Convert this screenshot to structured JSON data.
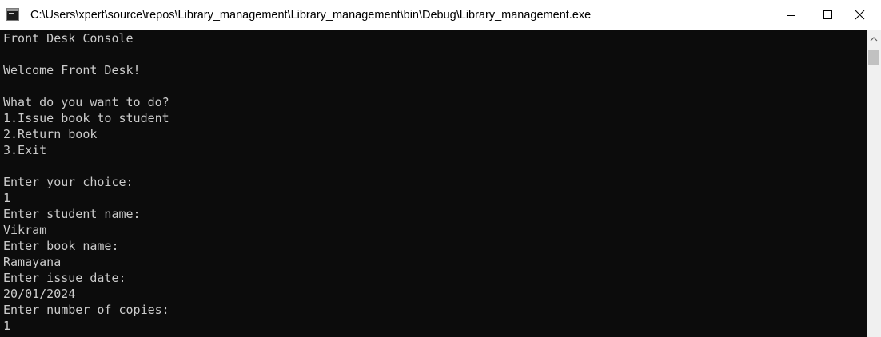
{
  "window": {
    "title": "C:\\Users\\xpert\\source\\repos\\Library_management\\Library_management\\bin\\Debug\\Library_management.exe",
    "app_icon": "console-app-icon",
    "controls": {
      "minimize_icon": "minimize-icon",
      "maximize_icon": "maximize-icon",
      "close_icon": "close-icon"
    }
  },
  "console": {
    "background_color": "#0c0c0c",
    "text_color": "#cccccc",
    "lines": [
      "Front Desk Console",
      "",
      "Welcome Front Desk!",
      "",
      "What do you want to do?",
      "1.Issue book to student",
      "2.Return book",
      "3.Exit",
      "",
      "Enter your choice:",
      "1",
      "Enter student name:",
      "Vikram",
      "Enter book name:",
      "Ramayana",
      "Enter issue date:",
      "20/01/2024",
      "Enter number of copies:",
      "1"
    ]
  },
  "scrollbar": {
    "up_arrow_icon": "chevron-up-icon"
  }
}
